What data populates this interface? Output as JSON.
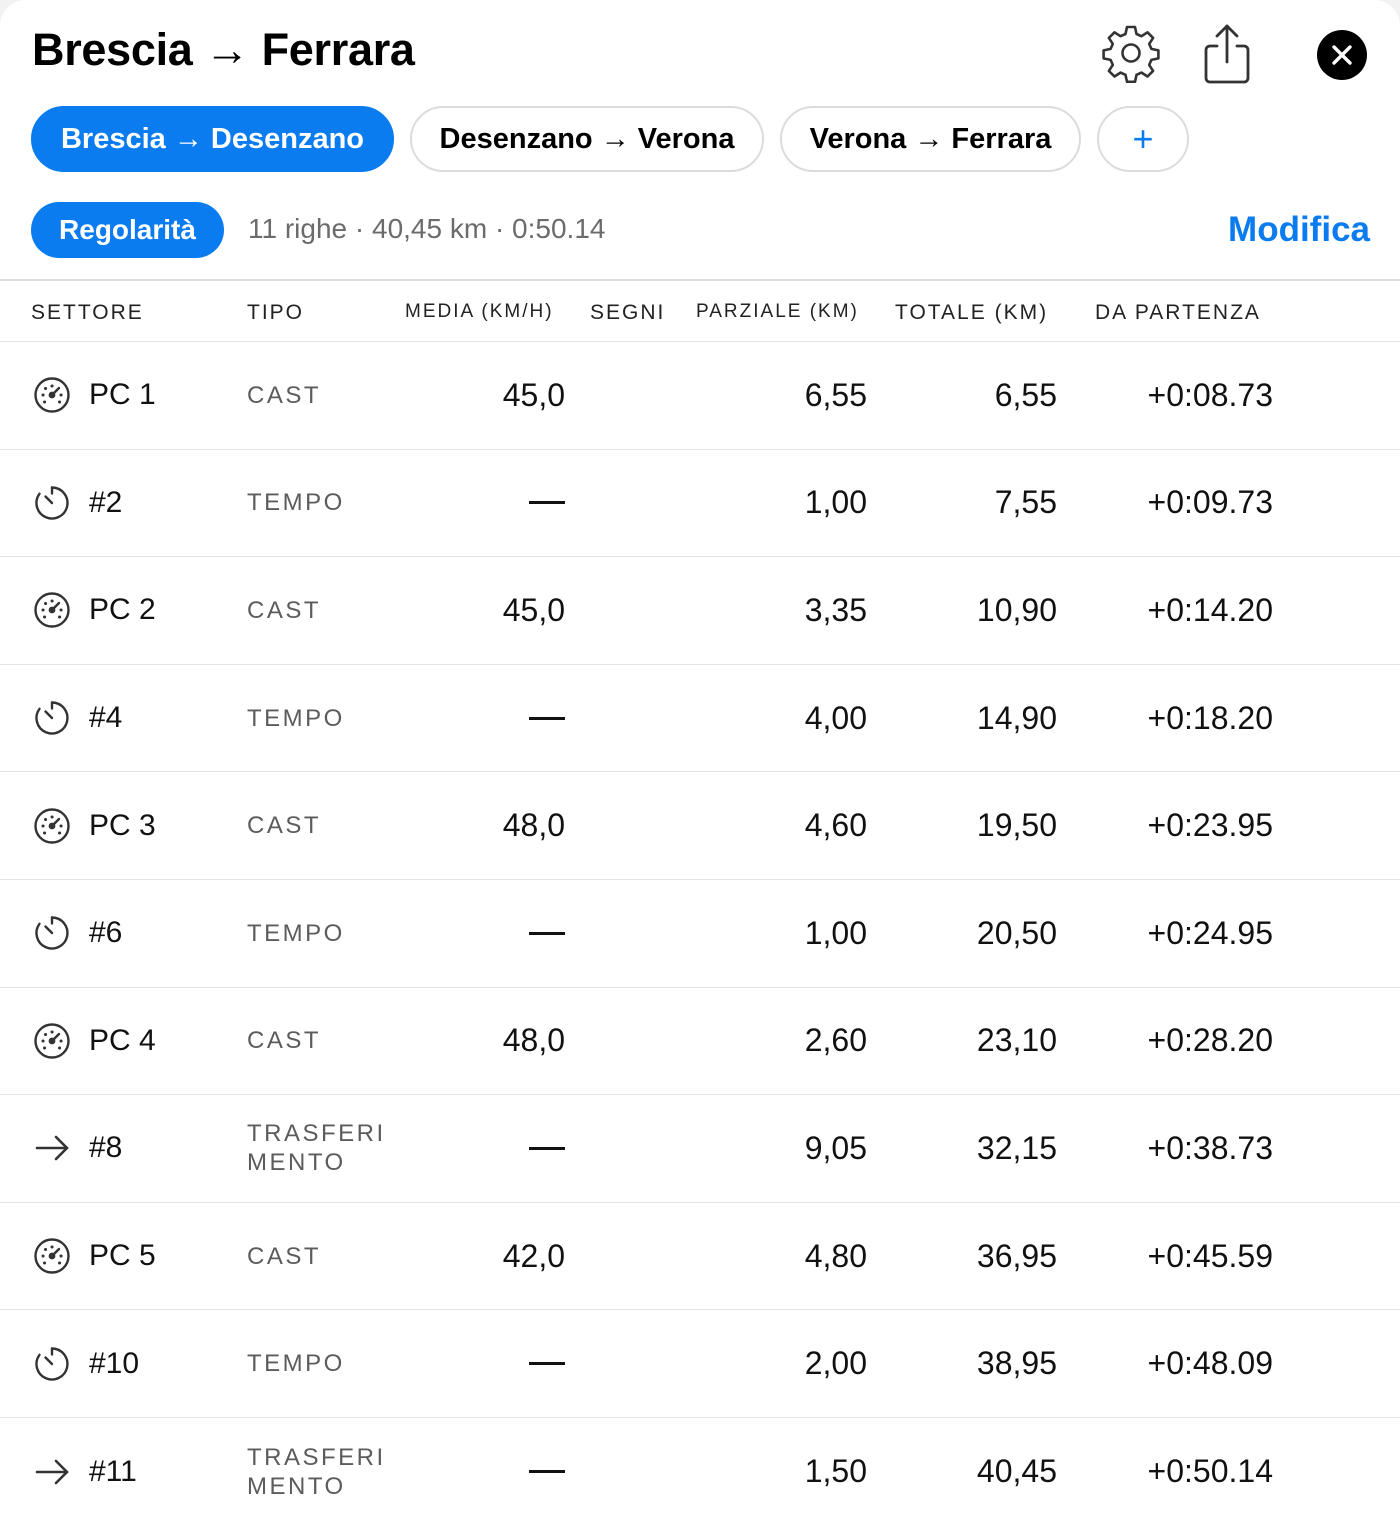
{
  "header": {
    "title": "Brescia → Ferrara",
    "settings_icon": "gear-icon",
    "share_icon": "share-icon",
    "close_icon": "close-icon"
  },
  "tabs": [
    {
      "label": "Brescia → Desenzano",
      "active": true
    },
    {
      "label": "Desenzano → Verona",
      "active": false
    },
    {
      "label": "Verona → Ferrara",
      "active": false
    }
  ],
  "add_tab_label": "+",
  "mode": {
    "label": "Regolarità"
  },
  "summary": "11 righe · 40,45 km · 0:50.14",
  "edit_label": "Modifica",
  "colors": {
    "accent": "#0a7cf0",
    "text": "#000000",
    "muted": "#6b6b6b",
    "divider": "#e4e4e4"
  },
  "columns": [
    "SETTORE",
    "TIPO",
    "MEDIA (KM/H)",
    "SEGNI",
    "PARZIALE (KM)",
    "TOTALE (KM)",
    "DA PARTENZA"
  ],
  "rows": [
    {
      "icon": "speedometer-icon",
      "label": "PC 1",
      "type": "CAST",
      "media": "45,0",
      "parziale": "6,55",
      "totale": "6,55",
      "da_partenza": "+0:08.73"
    },
    {
      "icon": "timer-icon",
      "label": "#2",
      "type": "TEMPO",
      "media": "—",
      "parziale": "1,00",
      "totale": "7,55",
      "da_partenza": "+0:09.73"
    },
    {
      "icon": "speedometer-icon",
      "label": "PC 2",
      "type": "CAST",
      "media": "45,0",
      "parziale": "3,35",
      "totale": "10,90",
      "da_partenza": "+0:14.20"
    },
    {
      "icon": "timer-icon",
      "label": "#4",
      "type": "TEMPO",
      "media": "—",
      "parziale": "4,00",
      "totale": "14,90",
      "da_partenza": "+0:18.20"
    },
    {
      "icon": "speedometer-icon",
      "label": "PC 3",
      "type": "CAST",
      "media": "48,0",
      "parziale": "4,60",
      "totale": "19,50",
      "da_partenza": "+0:23.95"
    },
    {
      "icon": "timer-icon",
      "label": "#6",
      "type": "TEMPO",
      "media": "—",
      "parziale": "1,00",
      "totale": "20,50",
      "da_partenza": "+0:24.95"
    },
    {
      "icon": "speedometer-icon",
      "label": "PC 4",
      "type": "CAST",
      "media": "48,0",
      "parziale": "2,60",
      "totale": "23,10",
      "da_partenza": "+0:28.20"
    },
    {
      "icon": "arrow-right-icon",
      "label": "#8",
      "type": "TRASFERIMENTO",
      "media": "—",
      "parziale": "9,05",
      "totale": "32,15",
      "da_partenza": "+0:38.73"
    },
    {
      "icon": "speedometer-icon",
      "label": "PC 5",
      "type": "CAST",
      "media": "42,0",
      "parziale": "4,80",
      "totale": "36,95",
      "da_partenza": "+0:45.59"
    },
    {
      "icon": "timer-icon",
      "label": "#10",
      "type": "TEMPO",
      "media": "—",
      "parziale": "2,00",
      "totale": "38,95",
      "da_partenza": "+0:48.09"
    },
    {
      "icon": "arrow-right-icon",
      "label": "#11",
      "type": "TRASFERIMENTO",
      "media": "—",
      "parziale": "1,50",
      "totale": "40,45",
      "da_partenza": "+0:50.14"
    }
  ]
}
